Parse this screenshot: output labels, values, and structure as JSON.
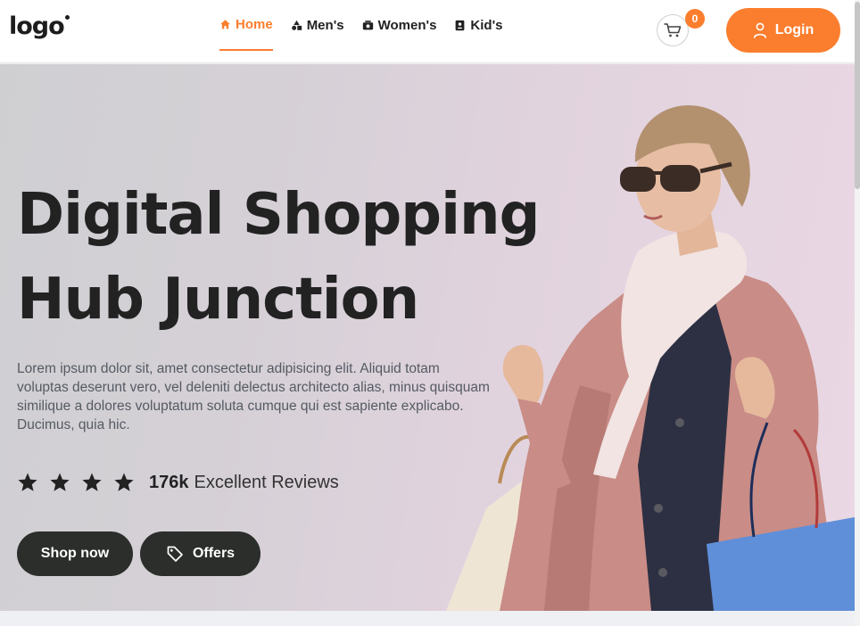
{
  "header": {
    "logo": "logo",
    "nav": [
      {
        "label": "Home",
        "icon": "home-icon",
        "active": true
      },
      {
        "label": "Men's",
        "icon": "shapes-icon",
        "active": false
      },
      {
        "label": "Women's",
        "icon": "photo-album-icon",
        "active": false
      },
      {
        "label": "Kid's",
        "icon": "contact-book-icon",
        "active": false
      }
    ],
    "cart_count": "0",
    "login_label": "Login"
  },
  "hero": {
    "headline_line1": "Digital Shopping",
    "headline_line2": "Hub Junction",
    "description": "Lorem ipsum dolor sit, amet consectetur adipisicing elit. Aliquid totam voluptas deserunt vero, vel deleniti delectus architecto alias, minus quisquam similique a dolores voluptatum soluta cumque qui est sapiente explicabo. Ducimus, quia hic.",
    "rating_stars": 4,
    "review_count": "176k",
    "review_label": "Excellent Reviews",
    "shop_now_label": "Shop now",
    "offers_label": "Offers",
    "image": "woman-shopping-photo"
  },
  "colors": {
    "accent": "#fb7e2e",
    "dark_button": "#2b2e2b",
    "text": "#222222"
  }
}
